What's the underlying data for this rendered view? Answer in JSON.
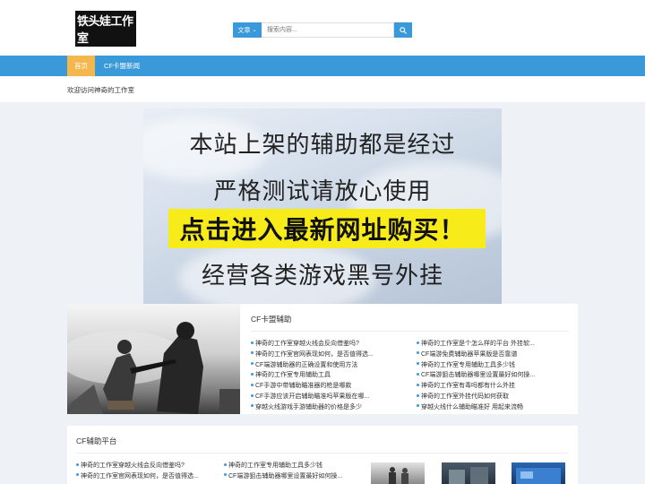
{
  "header": {
    "logo_text": "铁头娃工作室",
    "search": {
      "category_label": "文章",
      "placeholder": "搜索内容..."
    }
  },
  "nav": {
    "items": [
      {
        "label": "首页",
        "active": true
      },
      {
        "label": "CF卡盟新闻",
        "active": false
      }
    ]
  },
  "welcome": "欢迎访问神奇的工作室",
  "banner": {
    "lines": [
      "本站上架的辅助都是经过",
      "严格测试请放心使用",
      "点击进入最新网址购买！",
      "经营各类游戏黑号外挂"
    ]
  },
  "section1": {
    "title": "CF卡盟辅助",
    "left_list": [
      "神奇的工作室穿越火线会反向借鉴吗?",
      "神奇的工作室官网表现如何，是否值得选...",
      "CF端游辅助器的正确设置和使用方法",
      "神奇的工作室专用辅助工具",
      "CF手游中带辅助瞄准器的枪是哪款",
      "CF手游应该开启辅助瞄准吗苹果版在哪...",
      "穿越火线游戏手游辅助器的价格是多少"
    ],
    "right_list": [
      "神奇的工作室是个怎么样的平台 外挂软...",
      "CF端游免费辅助器苹果版是否靠谱",
      "神奇的工作室专用辅助工具多少钱",
      "CF端游狙击辅助器哪里设置最好如何操...",
      "神奇的工作室有毒吗都有什么外挂",
      "神奇的工作室外挂代码如何获取",
      "穿越火线什么辅助瞄准好 用起来流畅"
    ]
  },
  "section2": {
    "title": "CF辅助平台",
    "left_list": [
      "神奇的工作室穿越火线会反向借鉴吗?",
      "神奇的工作室官网表现如何，是否值得选..."
    ],
    "right_list": [
      "神奇的工作室专用辅助工具多少钱",
      "CF端游狙击辅助器哪里设置最好如何操..."
    ]
  },
  "colors": {
    "accent": "#3a99d8",
    "nav_active": "#f4b74e",
    "banner_highlight": "#f7ec1a",
    "page_bg": "#eef2f7"
  }
}
